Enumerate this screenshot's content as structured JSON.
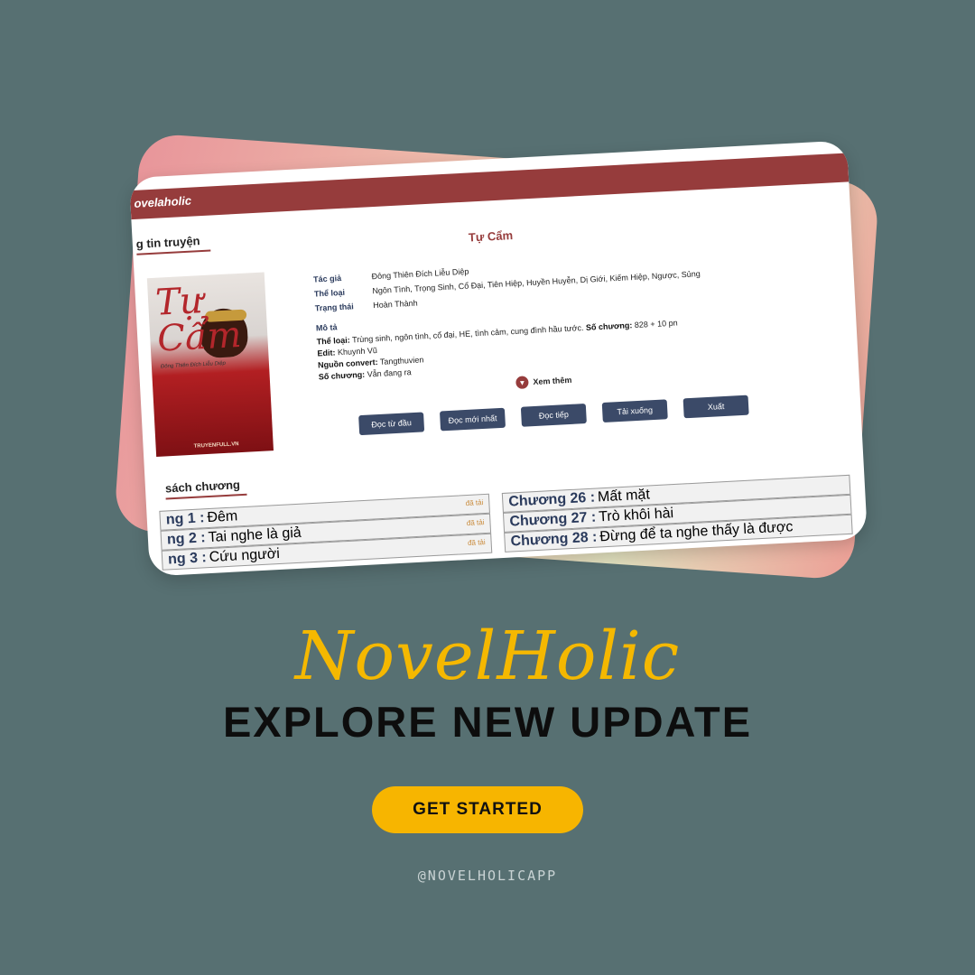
{
  "app": {
    "logo": "ovelaholic"
  },
  "info_section": {
    "title": "g tin truyện"
  },
  "book": {
    "title": "Tự Cẩm",
    "cover_title": "Tự Cẩm",
    "cover_author": "Đông Thiên Đích Liễu Diệp",
    "cover_brand": "TRUYENFULL.VN",
    "fields": [
      {
        "label": "Tác giả",
        "value": "Đông Thiên Đích Liễu Diệp"
      },
      {
        "label": "Thể loại",
        "value": "Ngôn Tình, Trọng Sinh, Cổ Đại, Tiên Hiệp, Huyền Huyễn, Dị Giới, Kiếm Hiệp, Ngược, Sủng"
      },
      {
        "label": "Trạng thái",
        "value": "Hoàn Thành"
      }
    ],
    "desc_label": "Mô tả",
    "desc": [
      {
        "label": "Thể loại:",
        "value": "Trùng sinh, ngôn tình, cổ đại, HE, tình cảm, cung đình hầu tước.",
        "label2": "Số chương:",
        "value2": "828 + 10 pn"
      },
      {
        "label": "Edit:",
        "value": "Khuynh Vũ"
      },
      {
        "label": "Nguồn convert:",
        "value": "Tangthuvien"
      },
      {
        "label": "Số chương:",
        "value": "Vẫn đang ra"
      }
    ],
    "see_more": "Xem thêm",
    "buttons": [
      "Đọc từ đầu",
      "Đọc mới nhất",
      "Đọc tiếp",
      "Tải xuống",
      "Xuất"
    ]
  },
  "chapters": {
    "title": "sách chương",
    "left": [
      {
        "num": "ng 1 :",
        "name": "Đêm",
        "status": "đã tải"
      },
      {
        "num": "ng 2 :",
        "name": "Tai nghe là giả",
        "status": "đã tải"
      },
      {
        "num": "ng 3 :",
        "name": "Cứu người",
        "status": "đã tải"
      }
    ],
    "right": [
      {
        "num": "Chương 26 :",
        "name": "Mất mặt"
      },
      {
        "num": "Chương 27 :",
        "name": "Trò khôi hài"
      },
      {
        "num": "Chương 28 :",
        "name": "Đừng để ta nghe thấy là được"
      }
    ]
  },
  "promo": {
    "brand": "NovelHolic",
    "headline": "EXPLORE NEW UPDATE",
    "cta": "GET STARTED",
    "handle": "@NOVELHOLICAPP"
  }
}
